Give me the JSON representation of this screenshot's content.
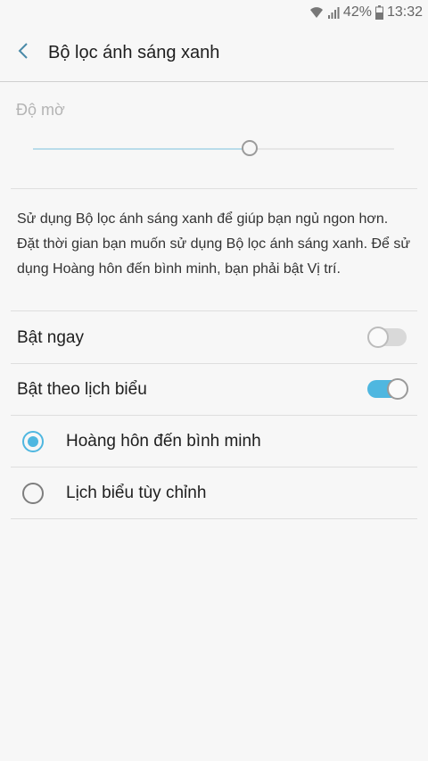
{
  "status_bar": {
    "battery": "42%",
    "time": "13:32"
  },
  "header": {
    "title": "Bộ lọc ánh sáng xanh"
  },
  "opacity": {
    "label": "Độ mờ",
    "value_fraction": 0.6
  },
  "description": "Sử dụng Bộ lọc ánh sáng xanh để giúp bạn ngủ ngon hơn. Đặt thời gian bạn muốn sử dụng Bộ lọc ánh sáng xanh. Để sử dụng Hoàng hôn đến bình minh, bạn phải bật Vị trí.",
  "settings": {
    "turn_on_now": {
      "label": "Bật ngay",
      "enabled": false
    },
    "turn_on_scheduled": {
      "label": "Bật theo lịch biểu",
      "enabled": true
    }
  },
  "schedule_options": [
    {
      "label": "Hoàng hôn đến bình minh",
      "selected": true
    },
    {
      "label": "Lịch biểu tùy chỉnh",
      "selected": false
    }
  ],
  "colors": {
    "accent": "#4fb7e0",
    "slider_fill": "#b9dcea"
  }
}
